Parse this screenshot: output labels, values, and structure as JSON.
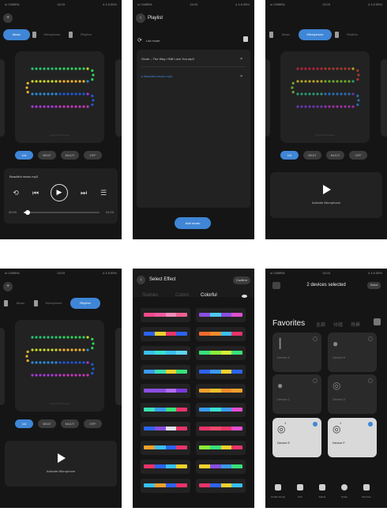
{
  "screen1": {
    "status": {
      "carrier": "ol CMBRA",
      "time": "13:03",
      "battery": "4 4 8 55%"
    },
    "tabs": [
      {
        "label": "Music",
        "active": true
      },
      {
        "label": "Microphone",
        "active": false
      },
      {
        "label": "Rhythm",
        "active": false
      }
    ],
    "canvas_caption": "Light Path Preview",
    "chips": [
      {
        "label": "1/4",
        "active": true
      },
      {
        "label": "BEAT",
        "active": false
      },
      {
        "label": "MULTI",
        "active": false
      },
      {
        "label": "OFF",
        "active": false
      }
    ],
    "player": {
      "song": "Beautiful music.mp3",
      "elapsed": "00:00",
      "total": "04:00",
      "progress": 0.05
    },
    "strip_colors": [
      "#27c46e",
      "#2fd35a",
      "#cbd82a",
      "#f1b22a",
      "#2a8ad9",
      "#1f58d8",
      "#a73ad6",
      "#c239b8"
    ]
  },
  "screen2": {
    "status": {
      "carrier": "ol CMBRA",
      "time": "13:03",
      "battery": "4 4 8 55%"
    },
    "title": "Playlist",
    "list_label": "List mode",
    "items": [
      {
        "name": "Ozzie – The Way I Still Love You.mp3",
        "playing": false
      },
      {
        "name": "Beautiful music.mp3",
        "playing": true
      }
    ],
    "add_button": "Add music"
  },
  "screen3": {
    "status": {
      "carrier": "ol CMBRA",
      "time": "13:03",
      "battery": "4 4 8 55%"
    },
    "tabs": [
      {
        "label": "Music",
        "active": false
      },
      {
        "label": "Microphone",
        "active": true
      },
      {
        "label": "Rhythm",
        "active": false
      }
    ],
    "canvas_caption": "Light Path Preview",
    "chips": [
      {
        "label": "1/4",
        "active": true
      },
      {
        "label": "BEAT",
        "active": false
      },
      {
        "label": "MULTI",
        "active": false
      },
      {
        "label": "OFF",
        "active": false
      }
    ],
    "activate_label": "Activate Microphone",
    "strip_colors": [
      "#b2243f",
      "#a63a2a",
      "#b5a528",
      "#6aa92b",
      "#2a9a7a",
      "#2a6db3",
      "#6a38b0",
      "#9b2fa0"
    ]
  },
  "screen4": {
    "status": {
      "carrier": "ol CMBRA",
      "time": "13:03",
      "battery": "4 4 8 55%"
    },
    "tabs": [
      {
        "label": "Music",
        "active": false
      },
      {
        "label": "Microphone",
        "active": false
      },
      {
        "label": "Rhythm",
        "active": true
      }
    ],
    "canvas_caption": "Light Path Preview",
    "chips": [
      {
        "label": "1/4",
        "active": true
      },
      {
        "label": "BEAT",
        "active": false
      },
      {
        "label": "MULTI",
        "active": false
      },
      {
        "label": "OFF",
        "active": false
      }
    ],
    "activate_label": "Activate Microphone",
    "strip_colors": [
      "#27c46e",
      "#2fd35a",
      "#cbd82a",
      "#f1b22a",
      "#2a8ad9",
      "#1f58d8",
      "#a73ad6",
      "#c239b8"
    ]
  },
  "screen5": {
    "title": "Select Effect",
    "confirm": "Confirm",
    "tabs": [
      {
        "label": "Scenes",
        "active": false
      },
      {
        "label": "Colors",
        "active": false
      },
      {
        "label": "Colorful",
        "active": true
      }
    ],
    "swatches": [
      [
        "#f04a8a",
        "#f05aa0",
        "#f48ab6",
        "#f06090"
      ],
      [
        "#8a4fe0",
        "#49c9f0",
        "#8a4fe0",
        "#e04fd0"
      ],
      [
        "#2c64f0",
        "#f0d12c",
        "#e8346a",
        "#2c64f0"
      ],
      [
        "#f06a2c",
        "#f08c2c",
        "#3ac0f0",
        "#e8346a"
      ],
      [
        "#3ac0f0",
        "#3ae0d0",
        "#3ac0f0",
        "#5fd6f0"
      ],
      [
        "#3ae07a",
        "#8af03a",
        "#d6f03a",
        "#3ae07a"
      ],
      [
        "#3a9af0",
        "#3ae0b0",
        "#f0d12c",
        "#3ae07a"
      ],
      [
        "#2c64f0",
        "#3a9af0",
        "#f0d12c",
        "#2c64f0"
      ],
      [
        "#8a4fe0",
        "#8a4fe0",
        "#b06af0",
        "#7a3ad6"
      ],
      [
        "#f0a02c",
        "#f0c02c",
        "#f08c2c",
        "#f0a02c"
      ],
      [
        "#3ae0b0",
        "#3a9af0",
        "#3ae07a",
        "#e8346a"
      ],
      [
        "#3a9af0",
        "#3ae0d0",
        "#3a9af0",
        "#e04fd0"
      ],
      [
        "#2c64f0",
        "#8a4fe0",
        "#e0e0f0",
        "#e8346a"
      ],
      [
        "#e8346a",
        "#f04a6a",
        "#e8346a",
        "#e04fd0"
      ],
      [
        "#f0a02c",
        "#3ac0f0",
        "#2c64f0",
        "#e8346a"
      ],
      [
        "#8af03a",
        "#3ae07a",
        "#f0d12c",
        "#e8346a"
      ],
      [
        "#e8346a",
        "#2c64f0",
        "#3ac0f0",
        "#f0d12c"
      ],
      [
        "#f0d12c",
        "#8a4fe0",
        "#3a9af0",
        "#3ae07a"
      ],
      [
        "#3ac0f0",
        "#f0a02c",
        "#2c64f0",
        "#e8346a"
      ],
      [
        "#e8346a",
        "#2c64f0",
        "#f0d12c",
        "#3ac0f0"
      ]
    ]
  },
  "screen6": {
    "status": {
      "carrier": "ol CMBRA",
      "time": "13:03",
      "battery": "4 4 8 55%"
    },
    "title": "2 devices selected",
    "done": "Select",
    "favorites": "Favorites",
    "tabs": [
      "全部",
      "分组",
      "场景"
    ],
    "devices": [
      {
        "name": "Device A",
        "sub": "",
        "selected": false,
        "icon": "light-icon"
      },
      {
        "name": "Device B",
        "sub": "",
        "selected": false,
        "icon": "bulb-icon"
      },
      {
        "name": "Device C",
        "sub": "",
        "selected": false,
        "icon": "bulb-icon"
      },
      {
        "name": "Device D",
        "sub": "",
        "selected": false,
        "icon": "ring-icon"
      },
      {
        "name": "Device E",
        "sub": "",
        "selected": true,
        "icon": "ring-icon",
        "count": "1"
      },
      {
        "name": "Device F",
        "sub": "",
        "selected": true,
        "icon": "ring-icon",
        "count": "1"
      }
    ],
    "toolbar": [
      "Create Group",
      "Sort",
      "Delete",
      "Setup",
      "Remove"
    ]
  }
}
